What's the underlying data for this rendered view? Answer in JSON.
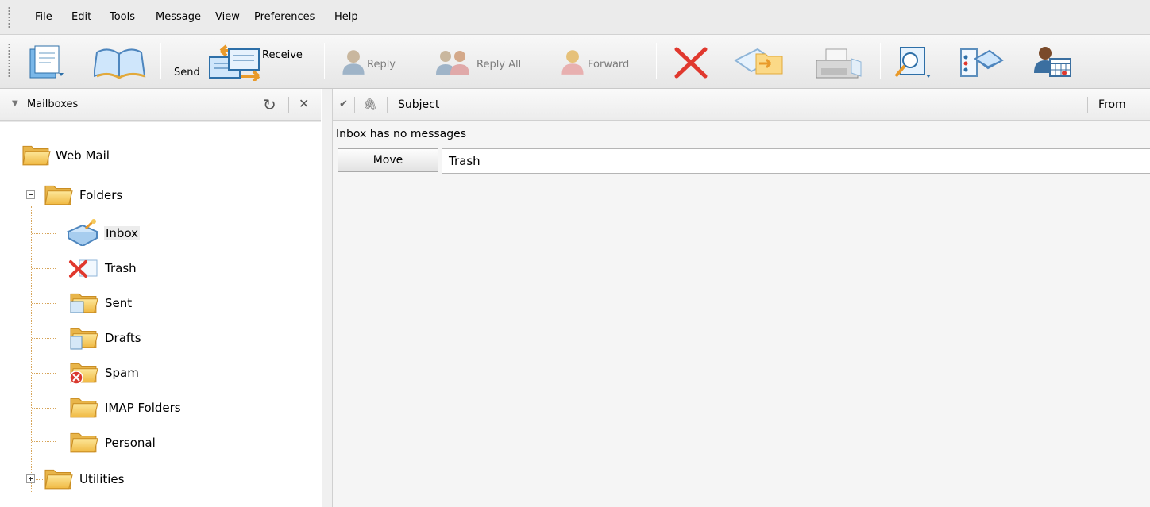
{
  "menubar": {
    "items": [
      "File",
      "Edit",
      "Tools",
      "Message",
      "View",
      "Preferences",
      "Help"
    ]
  },
  "toolbar": {
    "send_label": "Send",
    "receive_label": "Receive",
    "reply_label": "Reply",
    "reply_all_label": "Reply All",
    "forward_label": "Forward",
    "icons": [
      "new-message-icon",
      "address-book-icon",
      "send-receive-icon",
      "reply-icon",
      "reply-all-icon",
      "forward-icon",
      "delete-icon",
      "move-message-icon",
      "print-icon",
      "search-icon",
      "message-filter-icon",
      "calendar-user-icon"
    ]
  },
  "mailboxes": {
    "title": "Mailboxes",
    "tree": {
      "root": "Web Mail",
      "folders_label": "Folders",
      "folders": [
        "Inbox",
        "Trash",
        "Sent",
        "Drafts",
        "Spam",
        "IMAP Folders",
        "Personal"
      ],
      "utilities_label": "Utilities"
    }
  },
  "message_list": {
    "columns": {
      "subject": "Subject",
      "from": "From"
    },
    "empty_text": "Inbox has no messages",
    "move_label": "Move",
    "target_folder": "Trash"
  },
  "colors": {
    "folder_yellow": "#f5c85a",
    "folder_yellow_dark": "#e2a93b",
    "delete_red": "#e0382e",
    "panel_bg": "#f5f5f5"
  }
}
